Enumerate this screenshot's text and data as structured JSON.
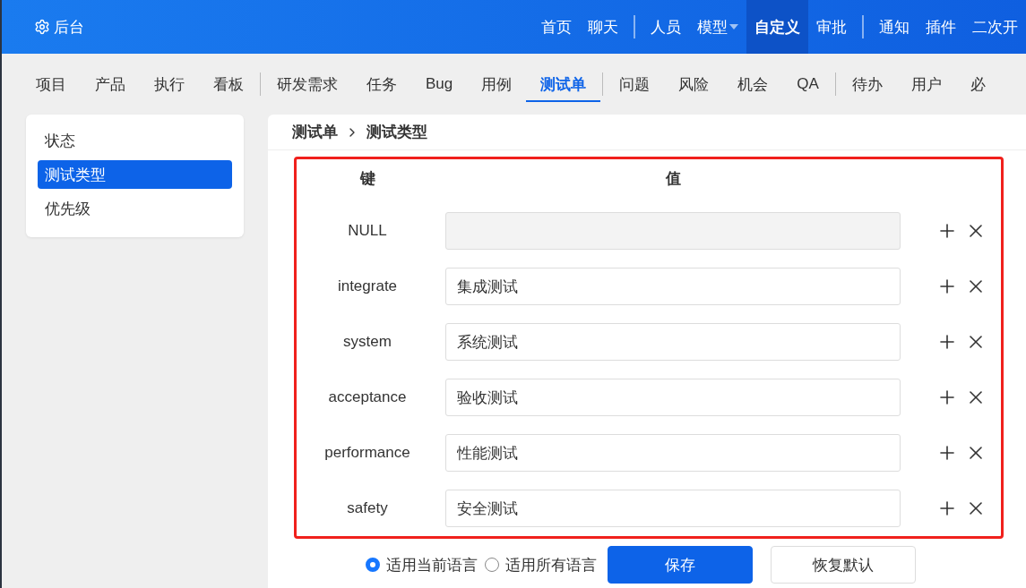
{
  "header": {
    "title": "后台",
    "nav_groups": [
      [
        {
          "label": "首页",
          "selected": false
        },
        {
          "label": "聊天",
          "selected": false
        }
      ],
      [
        {
          "label": "人员",
          "selected": false
        },
        {
          "label": "模型",
          "selected": false,
          "dropdown": true
        },
        {
          "label": "自定义",
          "selected": true
        },
        {
          "label": "审批",
          "selected": false
        }
      ],
      [
        {
          "label": "通知",
          "selected": false
        },
        {
          "label": "插件",
          "selected": false
        },
        {
          "label": "二次开",
          "selected": false
        }
      ]
    ]
  },
  "subnav_groups": [
    [
      {
        "label": "项目",
        "selected": false
      },
      {
        "label": "产品",
        "selected": false
      },
      {
        "label": "执行",
        "selected": false
      },
      {
        "label": "看板",
        "selected": false
      }
    ],
    [
      {
        "label": "研发需求",
        "selected": false
      },
      {
        "label": "任务",
        "selected": false
      },
      {
        "label": "Bug",
        "selected": false
      },
      {
        "label": "用例",
        "selected": false
      },
      {
        "label": "测试单",
        "selected": true
      }
    ],
    [
      {
        "label": "问题",
        "selected": false
      },
      {
        "label": "风险",
        "selected": false
      },
      {
        "label": "机会",
        "selected": false
      },
      {
        "label": "QA",
        "selected": false
      }
    ],
    [
      {
        "label": "待办",
        "selected": false
      },
      {
        "label": "用户",
        "selected": false
      },
      {
        "label": "必",
        "selected": false
      }
    ]
  ],
  "sidebar": {
    "items": [
      {
        "label": "状态",
        "selected": false
      },
      {
        "label": "测试类型",
        "selected": true
      },
      {
        "label": "优先级",
        "selected": false
      }
    ]
  },
  "breadcrumb": [
    "测试单",
    "测试类型"
  ],
  "table": {
    "columns": [
      "键",
      "值"
    ],
    "rows": [
      {
        "key": "NULL",
        "value": "",
        "disabled": true
      },
      {
        "key": "integrate",
        "value": "集成测试",
        "disabled": false
      },
      {
        "key": "system",
        "value": "系统测试",
        "disabled": false
      },
      {
        "key": "acceptance",
        "value": "验收测试",
        "disabled": false
      },
      {
        "key": "performance",
        "value": "性能测试",
        "disabled": false
      },
      {
        "key": "safety",
        "value": "安全测试",
        "disabled": false
      }
    ]
  },
  "language_options": [
    {
      "label": "适用当前语言",
      "selected": true
    },
    {
      "label": "适用所有语言",
      "selected": false
    }
  ],
  "buttons": [
    {
      "label": "保存",
      "kind": "primary"
    },
    {
      "label": "恢复默认",
      "kind": "secondary"
    }
  ]
}
